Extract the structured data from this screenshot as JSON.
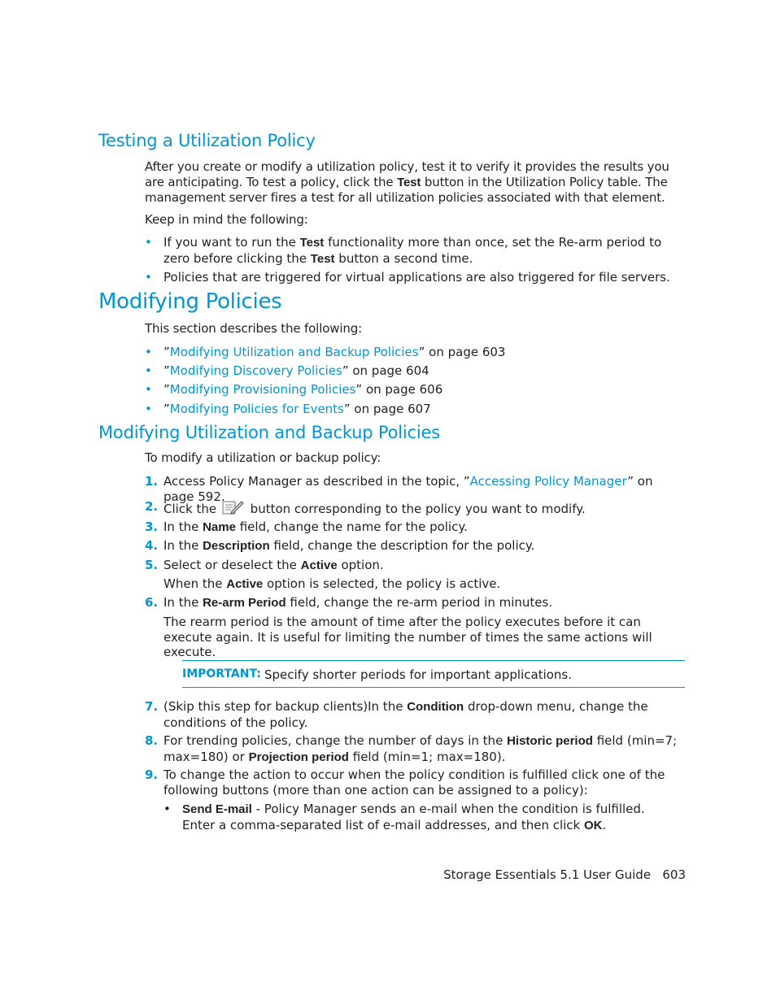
{
  "sections": {
    "testing": {
      "title": "Testing a Utilization Policy",
      "intro": [
        "After you create or modify a utilization policy, test it to verify it provides the results you are anticipating. To test a policy, click the ",
        "Test",
        " button in the Utilization Policy table. The management server fires a test for all utilization policies associated with that element."
      ],
      "keep_in_mind": "Keep in mind the following:",
      "bullets": [
        [
          "If you want to run the ",
          "Test",
          " functionality more than once, set the Re-arm period to zero before clicking the ",
          "Test",
          " button a second time."
        ],
        [
          "Policies that are triggered for virtual applications are also triggered for file servers."
        ]
      ]
    },
    "modifying": {
      "title": "Modifying Policies",
      "intro": "This section describes the following:",
      "links": [
        {
          "link": "Modifying Utilization and Backup Policies",
          "page": "603"
        },
        {
          "link": "Modifying Discovery Policies",
          "page": "604"
        },
        {
          "link": "Modifying Provisioning Policies",
          "page": "606"
        },
        {
          "link": "Modifying Policies for Events",
          "page": "607"
        }
      ],
      "open_quote": "”",
      "close_quote": "” on page "
    },
    "util_backup": {
      "title": "Modifying Utilization and Backup Policies",
      "intro": "To modify a utilization or backup policy:",
      "steps": {
        "s1": {
          "num": "1.",
          "a": "Access Policy Manager as described in the topic, ”",
          "link": "Accessing Policy Manager",
          "b": "” on page 592."
        },
        "s2": {
          "num": "2.",
          "a": "Click the ",
          "b": " button corresponding to the policy you want to modify."
        },
        "s3": {
          "num": "3.",
          "a": "In the ",
          "bold": "Name",
          "b": " field, change the name for the policy."
        },
        "s4": {
          "num": "4.",
          "a": "In the ",
          "bold": "Description",
          "b": " field, change the description for the policy."
        },
        "s5": {
          "num": "5.",
          "a": "Select or deselect the ",
          "bold": "Active",
          "b": " option."
        },
        "s5sub": {
          "a": "When the ",
          "bold": "Active",
          "b": " option is selected, the policy is active."
        },
        "s6": {
          "num": "6.",
          "a": "In the ",
          "bold": "Re-arm Period",
          "b": " field, change the re-arm period in minutes."
        },
        "s6sub": "The rearm period is the amount of time after the policy executes before it can execute again. It is useful for limiting the number of times the same actions will execute.",
        "s7": {
          "num": "7.",
          "a": "(Skip this step for backup clients)In the ",
          "bold": "Condition",
          "b": " drop-down menu, change the conditions of the policy."
        },
        "s8": {
          "num": "8.",
          "a": "For trending policies, change the number of days in the ",
          "bold1": "Historic period",
          "b": " field (min=7; max=180) or ",
          "bold2": "Projection period",
          "c": " field (min=1; max=180)."
        },
        "s9": {
          "num": "9.",
          "a": "To change the action to occur when the policy condition is fulfilled click one of the following buttons (more than one action can be assigned to a policy):"
        },
        "s9bullet": {
          "mark": "•",
          "bold": "Send E-mail",
          "a": " - Policy Manager sends an e-mail when the condition is fulfilled. Enter a comma-separated list of e-mail addresses, and then click ",
          "bold2": "OK",
          "b": "."
        }
      },
      "important": {
        "label": "IMPORTANT:",
        "text": "Specify shorter periods for important applications."
      }
    }
  },
  "bullet_mark": "•",
  "footer": {
    "guide": "Storage Essentials 5.1 User Guide",
    "page": "603"
  },
  "icons": {
    "edit": "edit-policy-icon"
  }
}
